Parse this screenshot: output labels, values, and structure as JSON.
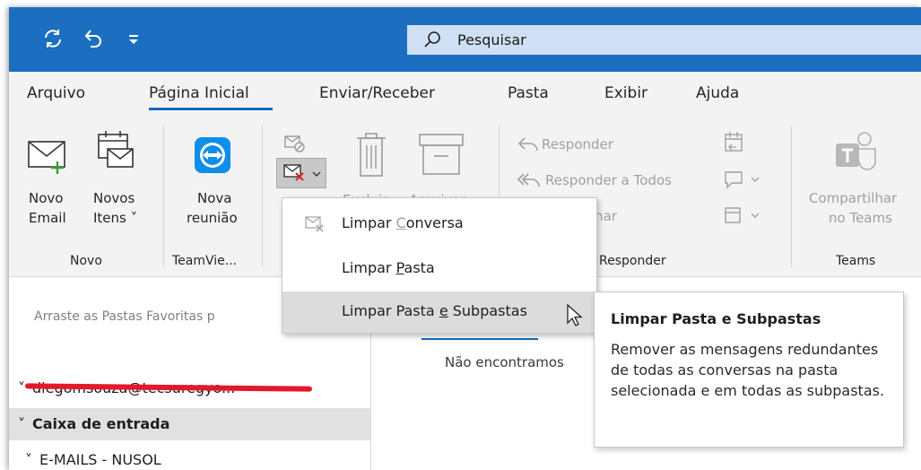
{
  "titlebar": {
    "sync_icon": "sync-icon",
    "undo_icon": "undo-icon",
    "customize_icon": "customize-qat-icon",
    "search_placeholder": "Pesquisar",
    "bg_color": "#1c6fc0"
  },
  "menu": {
    "tabs": [
      {
        "label": "Arquivo"
      },
      {
        "label": "Página Inicial",
        "active": true
      },
      {
        "label": "Enviar/Receber"
      },
      {
        "label": "Pasta"
      },
      {
        "label": "Exibir"
      },
      {
        "label": "Ajuda"
      }
    ]
  },
  "ribbon": {
    "novo": {
      "new_email_line1": "Novo",
      "new_email_line2": "Email",
      "new_items_line1": "Novos",
      "new_items_line2": "Itens ˅",
      "group_label": "Novo"
    },
    "teamviewer": {
      "meeting_line1": "Nova",
      "meeting_line2": "reunião",
      "group_label": "TeamVie..."
    },
    "delete_group": {
      "excluir": "Excluir",
      "arquivar": "Arquivar"
    },
    "responder": {
      "reply": "Responder",
      "reply_all": "Responder a Todos",
      "forward_partial": "ninhar",
      "group_label": "Responder"
    },
    "teams": {
      "share_line1": "Compartilhar",
      "share_line2": "no Teams",
      "group_label": "Teams"
    }
  },
  "cleanup_menu": {
    "items": [
      {
        "label_pre": "Limpar ",
        "label_u": "C",
        "label_post": "onversa",
        "disabled": true
      },
      {
        "label_pre": "Limpar ",
        "label_u": "P",
        "label_post": "asta",
        "disabled": false
      },
      {
        "label_pre": "Limpar Pasta ",
        "label_u": "e",
        "label_post": " Subpastas",
        "disabled": false,
        "hovered": true
      }
    ]
  },
  "tooltip": {
    "title": "Limpar Pasta e Subpastas",
    "body": "Remover as mensagens redundantes de todas as conversas na pasta selecionada e em todas as subpastas."
  },
  "folder_pane": {
    "favorites_hint": "Arraste as Pastas Favoritas p",
    "account": "diegomsouza@tecsuregyo...",
    "inbox": "Caixa de entrada",
    "subfolder": "E-MAILS - NUSOL"
  },
  "message_pane": {
    "empty_text": "Não encontramos"
  }
}
